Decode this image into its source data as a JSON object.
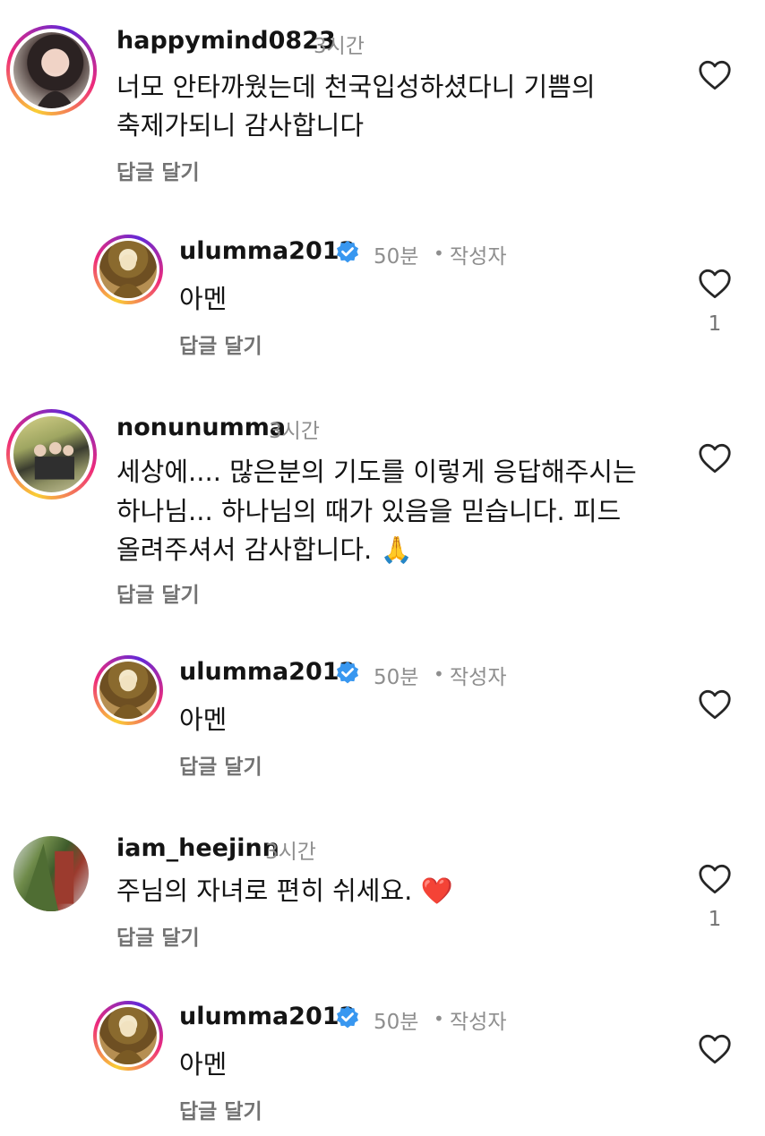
{
  "comments": [
    {
      "username": "happymind0823",
      "time": "3시간",
      "lines": [
        "너모 안타까웠는데 천국입성하셨다니 기쁨의",
        "축제가되니 감사합니다"
      ],
      "reply_label": "답글 달기",
      "likes": ""
    },
    {
      "username": "ulumma2012",
      "time": "50분",
      "author_label": "작성자",
      "lines": [
        "아멘"
      ],
      "reply_label": "답글 달기",
      "likes": "1"
    },
    {
      "username": "nonunumma",
      "time": "3시간",
      "lines": [
        "세상에.... 많은분의 기도를 이렇게 응답해주시는",
        "하나님... 하나님의 때가 있음을 믿습니다. 피드",
        "올려주셔서 감사합니다. 🙏"
      ],
      "reply_label": "답글 달기",
      "likes": ""
    },
    {
      "username": "ulumma2012",
      "time": "50분",
      "author_label": "작성자",
      "lines": [
        "아멘"
      ],
      "reply_label": "답글 달기",
      "likes": ""
    },
    {
      "username": "iam_heejinn",
      "time": "3시간",
      "lines": [
        "주님의 자녀로 편히 쉬세요. ❤️"
      ],
      "reply_label": "답글 달기",
      "likes": "1"
    },
    {
      "username": "ulumma2012",
      "time": "50분",
      "author_label": "작성자",
      "lines": [
        "아멘"
      ],
      "reply_label": "답글 달기",
      "likes": ""
    }
  ],
  "colors": {
    "verified": "#3897f0",
    "meta_gray": "#8e8e8e",
    "reply_gray": "#737373",
    "story_ring_start": "#f9ce34",
    "story_ring_end": "#ee2a7b"
  },
  "icons": {
    "like": "heart-outline-icon",
    "verified": "verified-badge-icon"
  }
}
